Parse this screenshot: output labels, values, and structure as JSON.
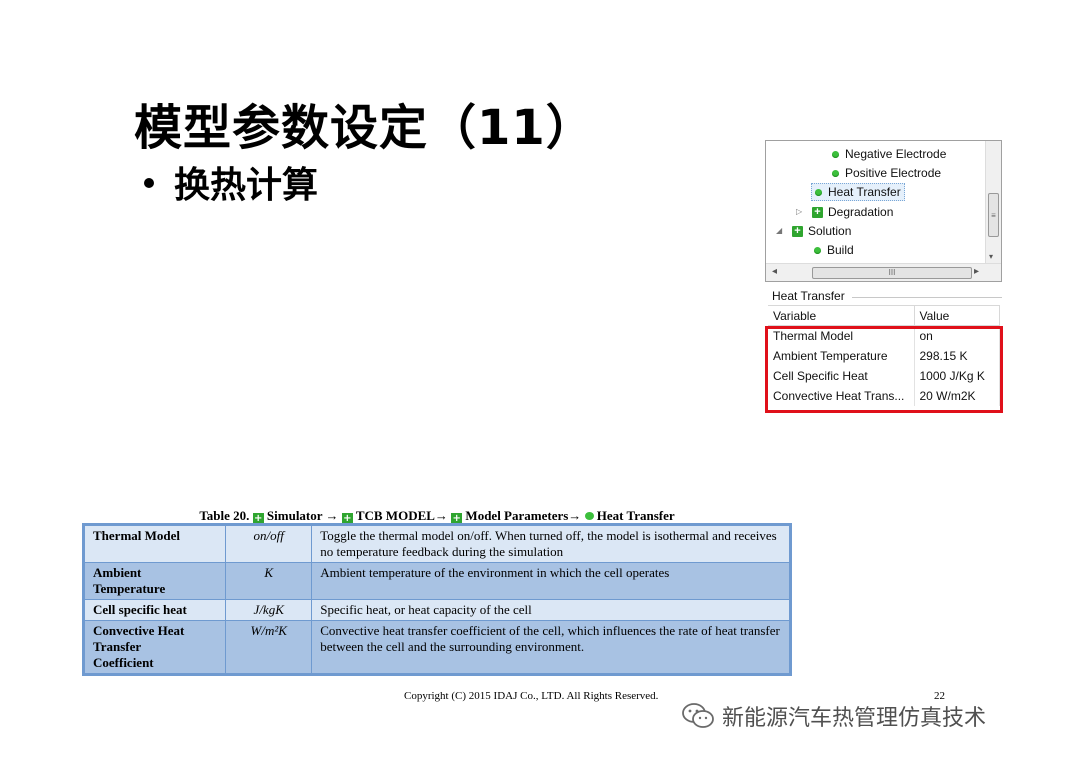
{
  "slide": {
    "title": "模型参数设定（11）",
    "bullet": "换热计算"
  },
  "tree": {
    "items": [
      {
        "label": "Negative Electrode",
        "icon": "leaf-dot-icon"
      },
      {
        "label": "Positive Electrode",
        "icon": "leaf-dot-icon"
      },
      {
        "label": "Heat Transfer",
        "icon": "leaf-dot-icon",
        "selected": true
      },
      {
        "label": "Degradation",
        "icon": "plus-icon",
        "expander": "▷"
      },
      {
        "label": "Solution",
        "icon": "plus-icon",
        "expander": "◢"
      },
      {
        "label": "Build",
        "icon": "leaf-dot-icon"
      }
    ],
    "vscroll_grip": "≡",
    "hscroll_grip": "III",
    "arrow_left": "◂",
    "arrow_right": "▸",
    "arrow_down": "▾"
  },
  "properties": {
    "group_title": "Heat Transfer",
    "col_variable": "Variable",
    "col_value": "Value",
    "rows": [
      {
        "variable": "Thermal Model",
        "value": "on"
      },
      {
        "variable": "Ambient Temperature",
        "value": "298.15 K"
      },
      {
        "variable": "Cell Specific Heat",
        "value": "1000 J/Kg K"
      },
      {
        "variable": "Convective Heat Trans...",
        "value": "20 W/m2K"
      }
    ],
    "highlight_color": "#e0101a"
  },
  "doc_table": {
    "caption_prefix": "Table 20.",
    "caption_parts": [
      "Simulator →",
      "TCB MODEL→",
      "Model Parameters→",
      "Heat Transfer"
    ],
    "rows": [
      {
        "name": "Thermal Model",
        "unit": "on/off",
        "desc": "Toggle the thermal model on/off. When turned off, the model is isothermal and receives no temperature feedback during the simulation"
      },
      {
        "name": "Ambient Temperature",
        "unit": "K",
        "desc": "Ambient temperature of the environment in which the cell operates"
      },
      {
        "name": "Cell specific heat",
        "unit": "J/kgK",
        "desc": "Specific heat, or heat capacity of the cell"
      },
      {
        "name": "Convective Heat Transfer Coefficient",
        "unit": "W/m²K",
        "desc": "Convective heat transfer coefficient of the cell, which influences the rate of heat transfer between the cell and the surrounding environment."
      }
    ],
    "row_colors": [
      "#dbe7f5",
      "#a8c2e3"
    ]
  },
  "footer": {
    "copyright": "Copyright (C) 2015 IDAJ Co., LTD. All Rights Reserved.",
    "page": "22"
  },
  "watermark": {
    "text": "新能源汽车热管理仿真技术",
    "icon": "wechat-icon"
  }
}
